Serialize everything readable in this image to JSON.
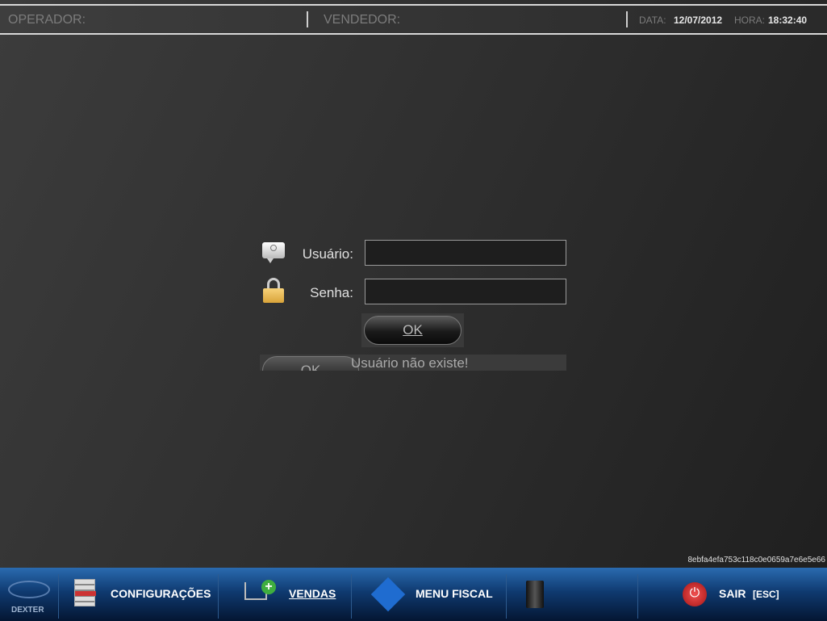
{
  "header": {
    "operador_label": "OPERADOR:",
    "vendedor_label": "VENDEDOR:",
    "data_label": "DATA:",
    "data_value": "12/07/2012",
    "hora_label": "HORA:",
    "hora_value": "18:32:40"
  },
  "login": {
    "usuario_label": "Usuário:",
    "senha_label": "Senha:",
    "usuario_value": "",
    "senha_value": "",
    "ok_label": "OK",
    "ghost_ok_label": "OK",
    "error_message": "Usuário não existe!"
  },
  "hash": "8ebfa4efa753c118c0e0659a7e6e5e66",
  "bottom": {
    "logo_text": "DEXTER",
    "configuracoes": "CONFIGURAÇÕES",
    "vendas": "VENDAS",
    "menu_fiscal": "MENU FISCAL",
    "sair": "SAIR",
    "sair_key": "[ESC]"
  }
}
